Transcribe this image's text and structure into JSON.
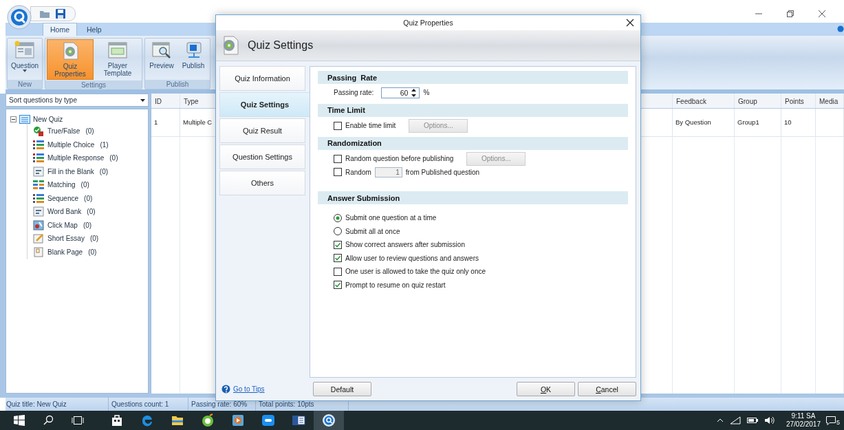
{
  "ribbon_tabs": [
    {
      "label": "Home",
      "selected": true
    },
    {
      "label": "Help",
      "selected": false
    }
  ],
  "ribbon_groups": [
    {
      "label": "New",
      "buttons": [
        {
          "label": "Question",
          "kind": "question",
          "selected": false,
          "dropdown": true
        }
      ]
    },
    {
      "label": "Settings",
      "buttons": [
        {
          "label": "Quiz Properties",
          "kind": "gear",
          "selected": true
        },
        {
          "label": "Player Template",
          "kind": "template",
          "selected": false
        }
      ]
    },
    {
      "label": "Publish",
      "buttons": [
        {
          "label": "Preview",
          "kind": "preview",
          "selected": false
        },
        {
          "label": "Publish",
          "kind": "publish",
          "selected": false
        }
      ]
    }
  ],
  "sidebar": {
    "sort_dropdown": "Sort questions by type",
    "tree": {
      "label": "New Quiz",
      "expanded": true,
      "children": [
        {
          "label": "True/False",
          "count": "(0)",
          "kind": "true_false"
        },
        {
          "label": "Multiple Choice",
          "count": "(1)",
          "kind": "multiple_choice"
        },
        {
          "label": "Multiple Response",
          "count": "(0)",
          "kind": "multiple_response"
        },
        {
          "label": "Fill in the Blank",
          "count": "(0)",
          "kind": "fill_blank"
        },
        {
          "label": "Matching",
          "count": "(0)",
          "kind": "matching"
        },
        {
          "label": "Sequence",
          "count": "(0)",
          "kind": "sequence"
        },
        {
          "label": "Word Bank",
          "count": "(0)",
          "kind": "word_bank"
        },
        {
          "label": "Click Map",
          "count": "(0)",
          "kind": "click_map"
        },
        {
          "label": "Short Essay",
          "count": "(0)",
          "kind": "short_essay"
        },
        {
          "label": "Blank Page",
          "count": "(0)",
          "kind": "blank_page"
        }
      ]
    }
  },
  "table": {
    "columns": [
      "ID",
      "Type",
      "Feedback",
      "Group",
      "Points",
      "Media"
    ],
    "rows": [
      {
        "cells": [
          "1",
          "Multiple C",
          "By Question",
          "Group1",
          "10"
        ]
      }
    ]
  },
  "status_bar": [
    "Quiz title: New Quiz",
    "Questions count: 1",
    "Passing rate: 60%",
    "Total points: 10pts"
  ],
  "dialog": {
    "title": "Quiz Properties",
    "header": "Quiz Settings",
    "nav": [
      {
        "label": "Quiz Information",
        "selected": false
      },
      {
        "label": "Quiz Settings",
        "selected": true
      },
      {
        "label": "Quiz Result",
        "selected": false
      },
      {
        "label": "Question Settings",
        "selected": false
      },
      {
        "label": "Others",
        "selected": false
      }
    ],
    "sections": [
      {
        "title": "Passing  Rate",
        "rows": [
          {
            "kind": "spinner",
            "label": "Passing rate:",
            "value": "60",
            "unit": "%"
          }
        ]
      },
      {
        "title": "Time Limit",
        "rows": [
          {
            "kind": "checkbox",
            "label": "Enable time limit",
            "checked": false,
            "button": "Options...",
            "button_disabled": true
          }
        ]
      },
      {
        "title": "Randomization",
        "rows": [
          {
            "kind": "checkbox",
            "label": "Random question before publishing",
            "checked": false,
            "button": "Options...",
            "button_disabled": true
          },
          {
            "kind": "checkbox_number",
            "label": "Random",
            "checked": false,
            "value": "1",
            "suffix": "from Published question"
          }
        ]
      },
      {
        "title": "Answer Submission",
        "rows": [
          {
            "kind": "radio",
            "label": "Submit one question at a time",
            "selected": true
          },
          {
            "kind": "radio",
            "label": "Submit all at once",
            "selected": false
          },
          {
            "kind": "checkbox",
            "label": "Show correct answers after submission",
            "checked": true
          },
          {
            "kind": "checkbox",
            "label": "Allow user to review questions and answers",
            "checked": true
          },
          {
            "kind": "checkbox",
            "label": "One user is allowed to take the quiz only once",
            "checked": false
          },
          {
            "kind": "checkbox",
            "label": "Prompt to resume on quiz restart",
            "checked": true
          }
        ]
      }
    ],
    "tips_link": "Go to Tips",
    "buttons": [
      {
        "label": "Default"
      },
      {
        "label": "OK",
        "access_key": true
      },
      {
        "label": "Cancel",
        "access_key": true
      }
    ]
  },
  "taskbar": {
    "apps": [
      {
        "kind": "store",
        "active": false
      },
      {
        "kind": "edge",
        "active": false
      },
      {
        "kind": "folder",
        "active": false
      },
      {
        "kind": "green",
        "active": false
      },
      {
        "kind": "video",
        "active": false
      },
      {
        "kind": "chat",
        "active": false
      },
      {
        "kind": "word",
        "active": false
      },
      {
        "kind": "quiz",
        "active": true
      }
    ],
    "time": "9:11 SA",
    "date": "27/02/2017",
    "notifications": "5"
  }
}
